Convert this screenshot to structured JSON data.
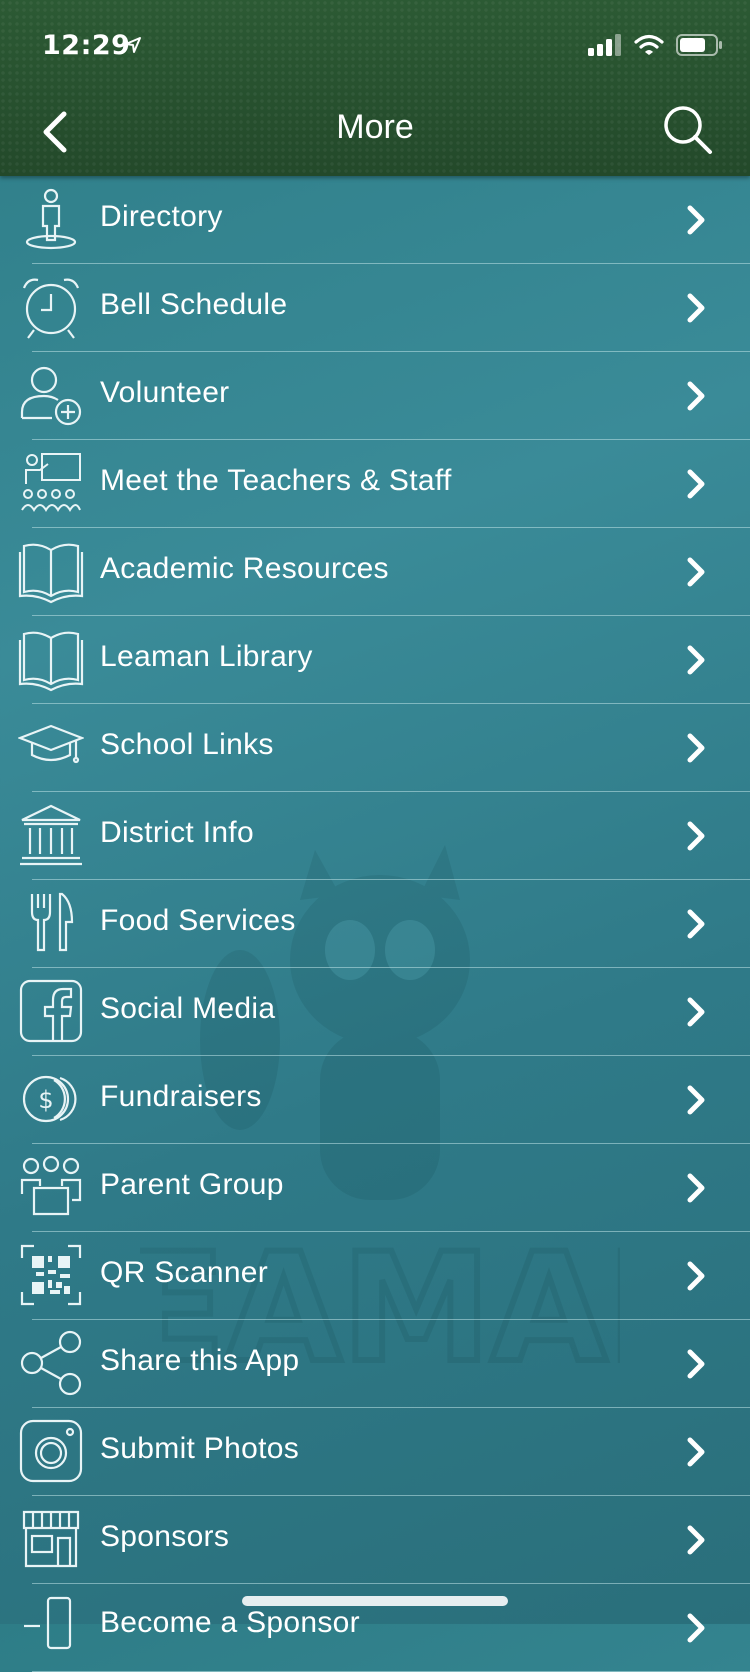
{
  "status_bar": {
    "time": "12:29"
  },
  "header": {
    "title": "More"
  },
  "items": [
    {
      "label": "Directory",
      "icon": "person-pin-icon"
    },
    {
      "label": "Bell Schedule",
      "icon": "alarm-clock-icon"
    },
    {
      "label": "Volunteer",
      "icon": "person-add-icon"
    },
    {
      "label": "Meet the Teachers & Staff",
      "icon": "teacher-class-icon"
    },
    {
      "label": "Academic Resources",
      "icon": "book-icon"
    },
    {
      "label": "Leaman Library",
      "icon": "book-icon"
    },
    {
      "label": "School Links",
      "icon": "graduation-cap-icon"
    },
    {
      "label": "District Info",
      "icon": "building-columns-icon"
    },
    {
      "label": "Food Services",
      "icon": "fork-knife-icon"
    },
    {
      "label": "Social Media",
      "icon": "facebook-icon"
    },
    {
      "label": "Fundraisers",
      "icon": "coins-icon"
    },
    {
      "label": "Parent Group",
      "icon": "group-icon"
    },
    {
      "label": "QR Scanner",
      "icon": "qr-code-icon"
    },
    {
      "label": "Share this App",
      "icon": "share-icon"
    },
    {
      "label": "Submit Photos",
      "icon": "camera-icon"
    },
    {
      "label": "Sponsors",
      "icon": "storefront-icon"
    },
    {
      "label": "Become a Sponsor",
      "icon": "phone-icon"
    }
  ],
  "watermark_text": "LEAMAN"
}
